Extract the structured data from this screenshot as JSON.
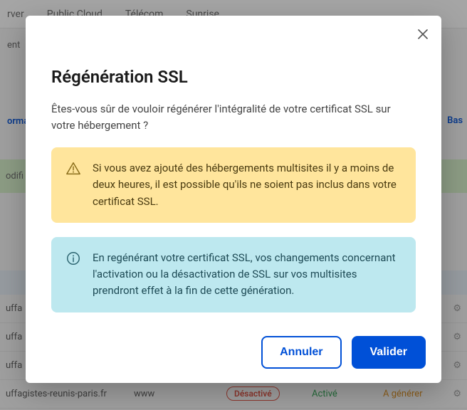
{
  "bg": {
    "nav": [
      "rver",
      "Public Cloud",
      "Télécom",
      "Sunrise"
    ],
    "side1": "ent",
    "tabs_active": "orma",
    "basc": "Bas",
    "greenbox": "odifi\ns.",
    "rows": [
      {
        "domain": "uffa",
        "folder": "",
        "ssl": "",
        "cdn": "",
        "status": ""
      },
      {
        "domain": "uffa",
        "folder": "",
        "ssl": "",
        "cdn": "",
        "status": ""
      },
      {
        "domain": "uffa",
        "folder": "",
        "ssl": "",
        "cdn": "",
        "status": ""
      },
      {
        "domain": "uffagistes-reunis-paris.fr",
        "folder": "www",
        "ssl": "Désactivé",
        "cdn": "Activé",
        "status": "A générer"
      }
    ]
  },
  "modal": {
    "title": "Régénération SSL",
    "question": "Êtes-vous sûr de vouloir régénérer l'intégralité de votre certificat SSL sur votre hébergement ?",
    "warning": "Si vous avez ajouté des hébergements multisites il y a moins de deux heures, il est possible qu'ils ne soient pas inclus dans votre certificat SSL.",
    "info": "En regénérant votre certificat SSL, vos changements concernant l'activation ou la désactivation de SSL sur vos multisites prendront effet à la fin de cette génération.",
    "cancel": "Annuler",
    "confirm": "Valider"
  }
}
